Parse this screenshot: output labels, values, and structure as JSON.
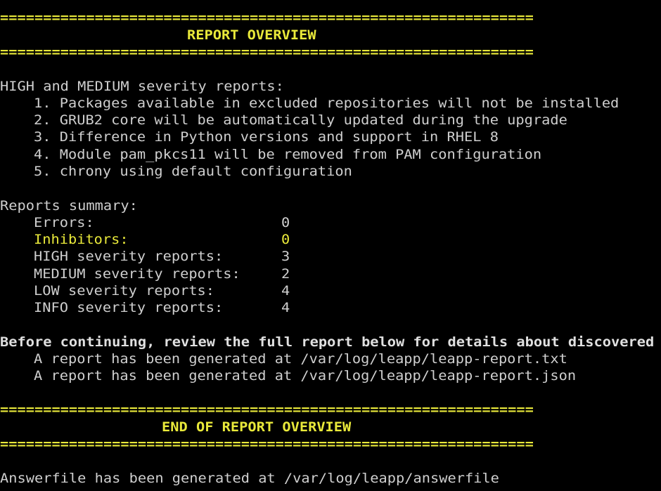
{
  "separator": "==============================================================",
  "header_title": "REPORT OVERVIEW",
  "severity_heading": "HIGH and MEDIUM severity reports:",
  "severity_items": [
    "1. Packages available in excluded repositories will not be installed",
    "2. GRUB2 core will be automatically updated during the upgrade",
    "3. Difference in Python versions and support in RHEL 8",
    "4. Module pam_pkcs11 will be removed from PAM configuration",
    "5. chrony using default configuration"
  ],
  "summary_heading": "Reports summary:",
  "summary": [
    {
      "label": "Errors:",
      "value": "0"
    },
    {
      "label": "Inhibitors:",
      "value": "0"
    },
    {
      "label": "HIGH severity reports:",
      "value": "3"
    },
    {
      "label": "MEDIUM severity reports:",
      "value": "2"
    },
    {
      "label": "LOW severity reports:",
      "value": "4"
    },
    {
      "label": "INFO severity reports:",
      "value": "4"
    }
  ],
  "review_notice": "Before continuing, review the full report below for details about discovered p",
  "report_paths": [
    "A report has been generated at /var/log/leapp/leapp-report.txt",
    "A report has been generated at /var/log/leapp/leapp-report.json"
  ],
  "footer_title": "END OF REPORT OVERVIEW",
  "answerfile_line": "Answerfile has been generated at /var/log/leapp/answerfile",
  "colors": {
    "background": "#000000",
    "text": "#cfcfcf",
    "highlight": "#e9e93a"
  }
}
